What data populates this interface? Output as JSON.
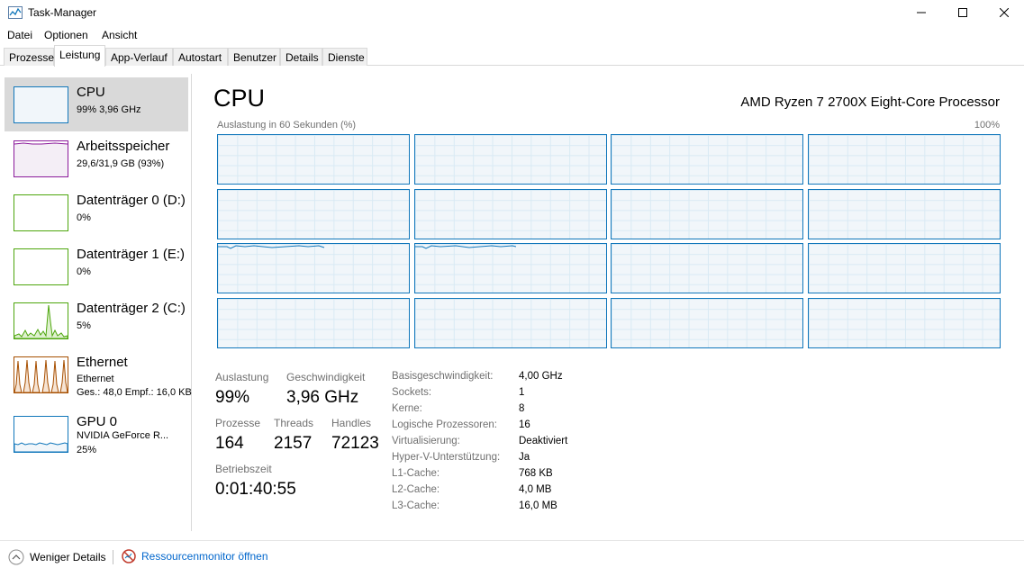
{
  "window": {
    "title": "Task-Manager",
    "icon": "task-manager-icon",
    "controls": [
      "minimize-icon",
      "maximize-icon",
      "close-icon"
    ]
  },
  "menu": [
    "Datei",
    "Optionen",
    "Ansicht"
  ],
  "tabs": [
    "Prozesse",
    "Leistung",
    "App-Verlauf",
    "Autostart",
    "Benutzer",
    "Details",
    "Dienste"
  ],
  "active_tab": "Leistung",
  "sidebar": {
    "items": [
      {
        "name": "CPU",
        "sub": "99% 3,96 GHz",
        "color": "#1177bb",
        "fill": "#f1f6fa",
        "usage": 99
      },
      {
        "name": "Arbeitsspeicher",
        "sub": "29,6/31,9 GB (93%)",
        "color": "#8b1a9b",
        "fill": "#f4eef6",
        "usage": 93
      },
      {
        "name": "Datenträger 0 (D:)",
        "sub": "0%",
        "color": "#4da60c",
        "usage": 0
      },
      {
        "name": "Datenträger 1 (E:)",
        "sub": "0%",
        "color": "#4da60c",
        "usage": 0
      },
      {
        "name": "Datenträger 2 (C:)",
        "sub": "5%",
        "color": "#4da60c",
        "usage": 5
      },
      {
        "name": "Ethernet",
        "sub": "Ethernet",
        "sub2": "Ges.: 48,0 Empf.: 16,0 KB",
        "color": "#a74f01"
      },
      {
        "name": "GPU 0",
        "sub": "NVIDIA GeForce R...",
        "sub2": "25%",
        "color": "#1177bb",
        "usage": 25
      }
    ]
  },
  "cpu": {
    "title": "CPU",
    "processor": "AMD Ryzen 7 2700X Eight-Core Processor",
    "graph_label": "Auslastung in 60 Sekunden (%)",
    "graph_max": "100%",
    "cores": 16,
    "stats": {
      "auslastung_label": "Auslastung",
      "auslastung": "99%",
      "geschwindigkeit_label": "Geschwindigkeit",
      "geschwindigkeit": "3,96 GHz",
      "prozesse_label": "Prozesse",
      "prozesse": "164",
      "threads_label": "Threads",
      "threads": "2157",
      "handles_label": "Handles",
      "handles": "72123",
      "betriebszeit_label": "Betriebszeit",
      "betriebszeit": "0:01:40:55"
    },
    "specs": [
      {
        "key": "Basisgeschwindigkeit:",
        "value": "4,00 GHz"
      },
      {
        "key": "Sockets:",
        "value": "1"
      },
      {
        "key": "Kerne:",
        "value": "8"
      },
      {
        "key": "Logische Prozessoren:",
        "value": "16"
      },
      {
        "key": "Virtualisierung:",
        "value": "Deaktiviert"
      },
      {
        "key": "Hyper-V-Unterstützung:",
        "value": "Ja"
      },
      {
        "key": "L1-Cache:",
        "value": "768 KB"
      },
      {
        "key": "L2-Cache:",
        "value": "4,0 MB"
      },
      {
        "key": "L3-Cache:",
        "value": "16,0 MB"
      }
    ]
  },
  "footer": {
    "less_details": "Weniger Details",
    "resource_monitor": "Ressourcenmonitor öffnen"
  }
}
